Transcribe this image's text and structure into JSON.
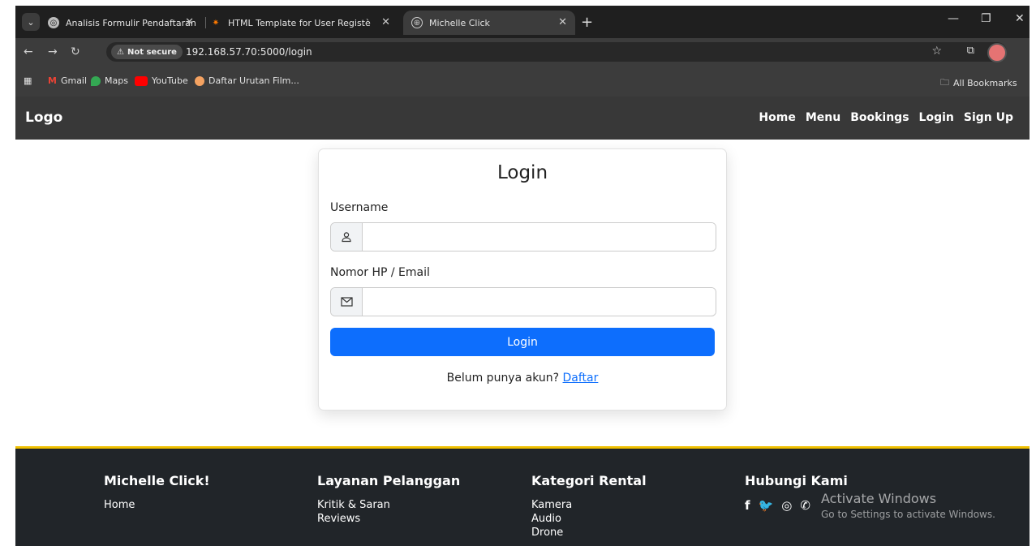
{
  "browser": {
    "tabs": [
      {
        "title": "Analisis Formulir Pendaftaran"
      },
      {
        "title": "HTML Template for User Registè"
      },
      {
        "title": "Michelle Click"
      }
    ],
    "address": {
      "security": "Not secure",
      "url": "192.168.57.70:5000/login"
    },
    "bookmarks": [
      {
        "label": "Gmail"
      },
      {
        "label": "Maps"
      },
      {
        "label": "YouTube"
      },
      {
        "label": "Daftar Urutan Film..."
      }
    ],
    "all_bookmarks": "All Bookmarks"
  },
  "navbar": {
    "logo": "Logo",
    "links": [
      "Home",
      "Menu",
      "Bookings",
      "Login",
      "Sign Up"
    ]
  },
  "login": {
    "title": "Login",
    "username_label": "Username",
    "username_value": "",
    "contact_label": "Nomor HP / Email",
    "contact_value": "",
    "submit_label": "Login",
    "signup_prompt": "Belum punya akun?",
    "signup_link": "Daftar"
  },
  "footer": {
    "columns": [
      {
        "title": "Michelle Click!",
        "links": [
          "Home"
        ]
      },
      {
        "title": "Layanan Pelanggan",
        "links": [
          "Kritik & Saran",
          "Reviews"
        ]
      },
      {
        "title": "Kategori Rental",
        "links": [
          "Kamera",
          "Audio",
          "Drone"
        ]
      },
      {
        "title": "Hubungi Kami",
        "social": [
          "facebook-icon",
          "twitter-icon",
          "instagram-icon",
          "whatsapp-icon"
        ]
      }
    ]
  },
  "os_overlay": {
    "title": "Activate Windows",
    "subtitle": "Go to Settings to activate Windows."
  },
  "colors": {
    "primary": "#0d6efd",
    "navbar": "#383838",
    "footer": "#212529",
    "footer_accent": "#f0c000"
  }
}
